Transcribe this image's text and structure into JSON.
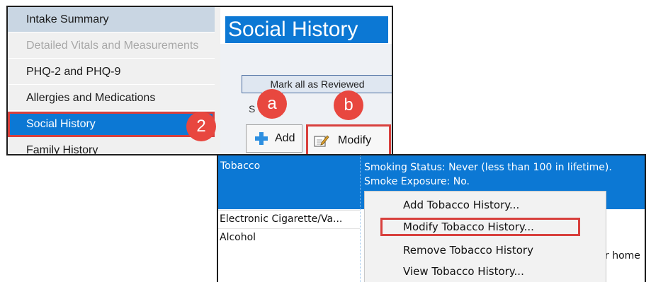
{
  "sidebar": {
    "items": [
      {
        "label": "Intake Summary"
      },
      {
        "label": "Detailed Vitals and Measurements"
      },
      {
        "label": "PHQ-2 and PHQ-9"
      },
      {
        "label": "Allergies and Medications"
      },
      {
        "label": "Social History"
      },
      {
        "label": "Family History"
      }
    ],
    "selected_badge": "2"
  },
  "header": {
    "title": "Social History"
  },
  "toolbar": {
    "mark_all_label": "Mark all as Reviewed",
    "group_label": "S",
    "add_label": "Add",
    "modify_label": "Modify",
    "badge_a": "a",
    "badge_b": "b"
  },
  "grid": {
    "selected_row": {
      "category": "Tobacco",
      "detail_line1": "Smoking Status: Never (less than 100 in lifetime).",
      "detail_line2": "Smoke Exposure: No."
    },
    "rows": [
      {
        "category": "Electronic Cigarette/Va..."
      },
      {
        "category": "Alcohol"
      }
    ],
    "partial_text": "r home"
  },
  "context_menu": {
    "items": [
      {
        "label": "Add Tobacco History..."
      },
      {
        "label": "Modify Tobacco History..."
      },
      {
        "label": "Remove Tobacco History"
      },
      {
        "label": "View Tobacco History..."
      }
    ]
  },
  "colors": {
    "accent": "#0c78d4",
    "highlight": "#d8403d",
    "badge": "#e8473f"
  }
}
